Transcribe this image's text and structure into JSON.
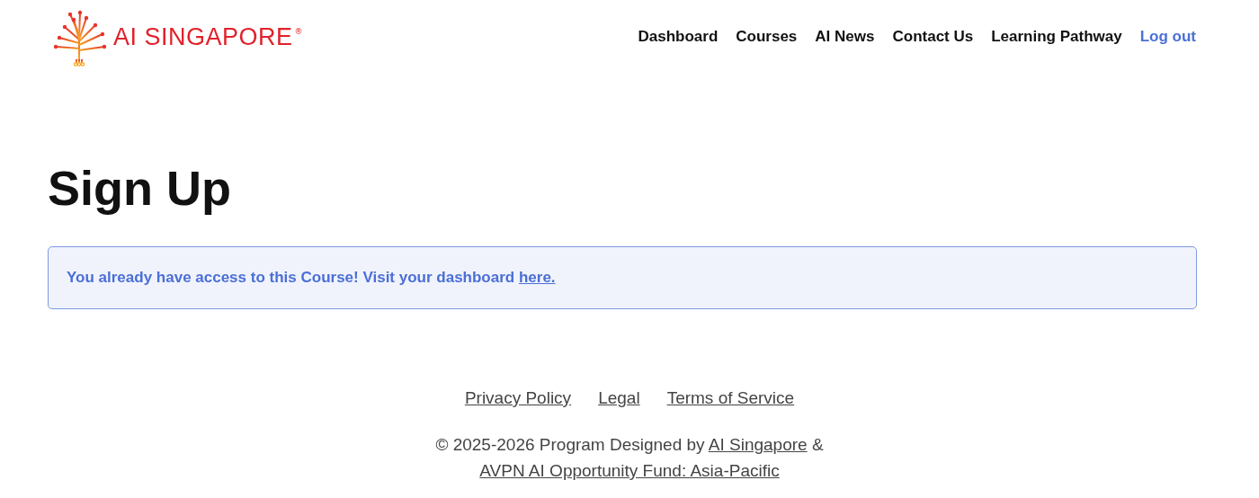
{
  "logo": {
    "text": "AI SINGAPORE",
    "mark": "®"
  },
  "nav": [
    {
      "label": "Dashboard",
      "kind": "link"
    },
    {
      "label": "Courses",
      "kind": "link"
    },
    {
      "label": "AI News",
      "kind": "link"
    },
    {
      "label": "Contact Us",
      "kind": "link"
    },
    {
      "label": "Learning Pathway",
      "kind": "link"
    },
    {
      "label": "Log out",
      "kind": "action"
    }
  ],
  "title": "Sign Up",
  "notice": {
    "text": "You already have access to this Course! Visit your dashboard",
    "link": "here."
  },
  "footer_links": [
    "Privacy Policy",
    "Legal",
    "Terms of Service"
  ],
  "copyright": {
    "text": "© 2025-2026 Program Designed by",
    "link_1": "AI Singapore",
    "joiner": "&",
    "link_2": "AVPN AI Opportunity Fund: Asia-Pacific"
  }
}
